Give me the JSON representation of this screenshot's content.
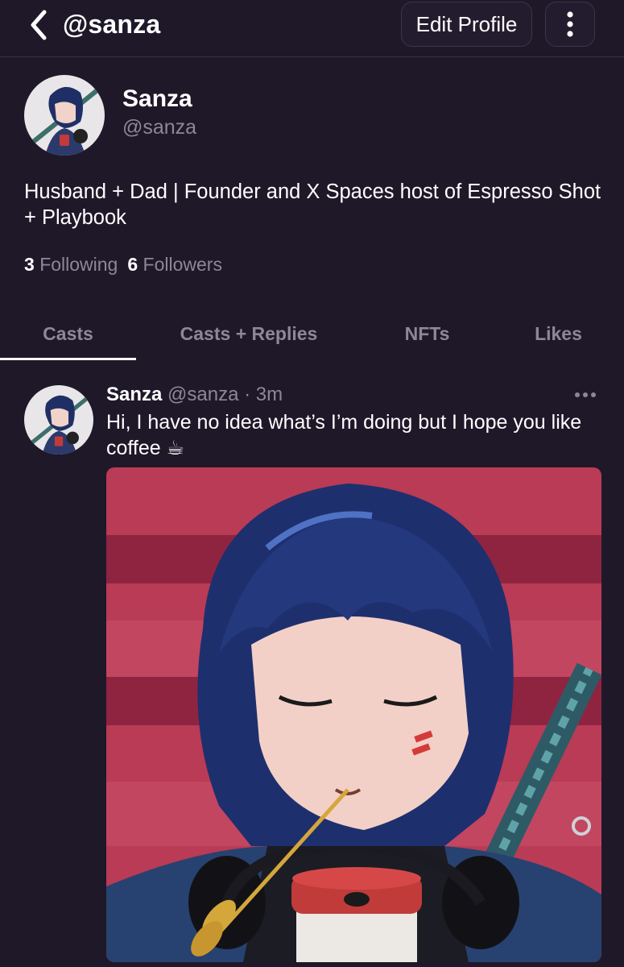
{
  "header": {
    "title": "@sanza",
    "edit_label": "Edit Profile",
    "back_icon": "chevron-left-icon",
    "more_icon": "vertical-dots-icon"
  },
  "profile": {
    "display_name": "Sanza",
    "handle": "@sanza",
    "bio": "Husband + Dad | Founder and X Spaces host of Espresso Shot + Playbook",
    "following_count": "3",
    "following_label": "Following",
    "followers_count": "6",
    "followers_label": "Followers"
  },
  "tabs": [
    {
      "label": "Casts",
      "active": true
    },
    {
      "label": "Casts + Replies",
      "active": false
    },
    {
      "label": "NFTs",
      "active": false
    },
    {
      "label": "Likes",
      "active": false
    }
  ],
  "cast": {
    "author_name": "Sanza",
    "author_handle": "@sanza",
    "separator": "·",
    "time": "3m",
    "text": "Hi, I have no idea what’s I’m doing but I hope you like coffee ☕"
  },
  "colors": {
    "background": "#1f1829",
    "muted_text": "#8e8799",
    "border": "#3d3548",
    "image_bg": "#b93b55"
  }
}
